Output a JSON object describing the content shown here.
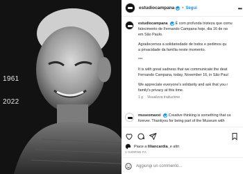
{
  "photo": {
    "year_start": "1961",
    "year_end": "2022"
  },
  "post": {
    "username": "estudiocampana",
    "separator": "•",
    "follow_label": "Segui",
    "caption_user": "estudiocampana",
    "caption_lines": [
      "É com profunda tristeza que comu",
      "falecimento de Fernando Campana hoje, dia 16 de no",
      "em São Paulo."
    ],
    "caption_p2": [
      "Agradecemos a solidariedade de todos e pedimos qu",
      "a privacidade da família neste momento."
    ],
    "caption_p3": "***",
    "caption_p4": [
      "It is with great sadness that we communicate the deat",
      "Fernando Campana, today, November 16, in São Paul"
    ],
    "caption_p5": [
      "We appreciate everyone's solidarity and ask that you r",
      "family's privacy at this time."
    ],
    "caption_time": "1 g",
    "translation_label": "Visualizza traduzione",
    "comment_user": "museomaxxi",
    "comment_lines": [
      "Creative thinking is something that ca",
      "forever. Thankyou for being part of the Museum with"
    ],
    "likes_text_prefix": "Piace a ",
    "likes_user": "liliancardia_",
    "likes_text_suffix": " e altri",
    "date": "1 GIORNO FA",
    "comment_placeholder": "Aggiungi un commento..."
  },
  "icons": [
    "heart-icon",
    "comment-icon",
    "share-icon",
    "save-icon",
    "emoji-icon",
    "more-icon",
    "verified-icon"
  ],
  "colors": {
    "accent": "#0095f6",
    "text": "#262626",
    "muted": "#737373"
  }
}
